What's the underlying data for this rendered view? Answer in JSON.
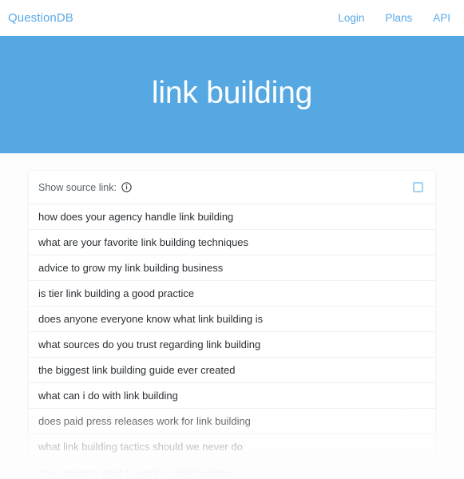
{
  "navbar": {
    "brand": "QuestionDB",
    "links": [
      {
        "label": "Login",
        "name": "nav-link-login"
      },
      {
        "label": "Plans",
        "name": "nav-link-plans"
      },
      {
        "label": "API",
        "name": "nav-link-api"
      }
    ]
  },
  "hero": {
    "title": "link building",
    "background_color": "#55a8e2",
    "text_color": "#ffffff"
  },
  "toolbar": {
    "label": "Show source link:",
    "info_icon": "info-circle-icon",
    "checkbox_checked": false,
    "checkbox_border_color": "#a4d2f2"
  },
  "results": {
    "items": [
      "how does your agency handle link building",
      "what are your favorite link building techniques",
      "advice to grow my link building business",
      "is tier link building a good practice",
      "does anyone everyone know what link building is",
      "what sources do you trust regarding link building",
      "the biggest link building guide ever created",
      "what can i do with link building",
      "does paid press releases work for link building",
      "what link building tactics should we never do",
      "does anyone want to work on link building"
    ]
  },
  "colors": {
    "accent": "#5aa9e6",
    "page_background": "#fdfdfd",
    "card_background": "#ffffff",
    "row_text": "#2b2f33",
    "divider": "#eff1f2"
  }
}
